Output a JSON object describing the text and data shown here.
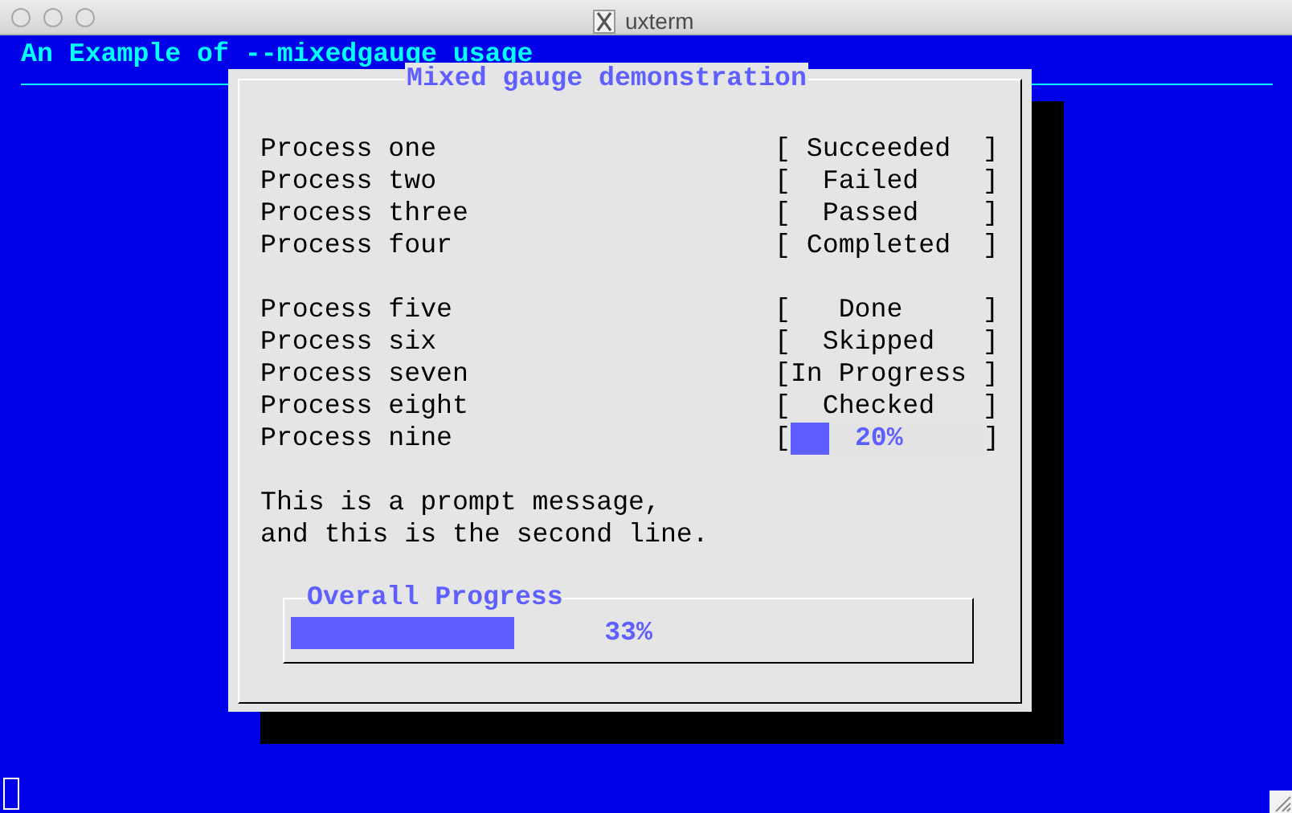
{
  "window": {
    "title": "uxterm"
  },
  "backtitle": "An Example of --mixedgauge usage",
  "dialog": {
    "title": "Mixed gauge demonstration",
    "groups": [
      [
        {
          "label": "Process one",
          "kind": "status",
          "status": "[ Succeeded  ]"
        },
        {
          "label": "Process two",
          "kind": "status",
          "status": "[  Failed    ]"
        },
        {
          "label": "Process three",
          "kind": "status",
          "status": "[  Passed    ]"
        },
        {
          "label": "Process four",
          "kind": "status",
          "status": "[ Completed  ]"
        }
      ],
      [
        {
          "label": "Process five",
          "kind": "status",
          "status": "[   Done     ]"
        },
        {
          "label": "Process six",
          "kind": "status",
          "status": "[  Skipped   ]"
        },
        {
          "label": "Process seven",
          "kind": "status",
          "status": "[In Progress ]"
        },
        {
          "label": "Process eight",
          "kind": "status",
          "status": "[  Checked   ]"
        },
        {
          "label": "Process nine",
          "kind": "gauge",
          "open": "[",
          "close": "]",
          "level": 0.2,
          "reading": "20%"
        }
      ]
    ],
    "prompt": "This is a prompt message,\nand this is the second line.",
    "overall": {
      "title": "Overall Progress",
      "level": 0.33,
      "reading": "33%"
    }
  }
}
